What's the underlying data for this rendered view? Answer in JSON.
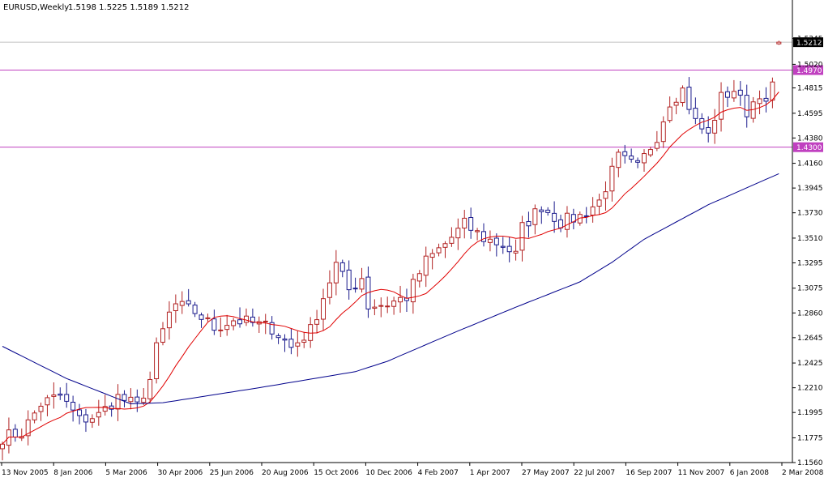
{
  "header": {
    "symbol": "EURUSD,Weekly",
    "ohlc": "1.5198 1.5225 1.5189 1.5212"
  },
  "chart_data": {
    "type": "candlestick",
    "symbol": "EURUSD",
    "timeframe": "Weekly",
    "title": "EURUSD,Weekly",
    "ylim": [
      1.156,
      1.5445
    ],
    "y_ticks": [
      "1.5245",
      "1.5020",
      "1.4815",
      "1.4595",
      "1.4380",
      "1.4160",
      "1.3945",
      "1.3730",
      "1.3510",
      "1.3295",
      "1.3075",
      "1.2860",
      "1.2645",
      "1.2425",
      "1.2210",
      "1.1995",
      "1.1775",
      "1.1560"
    ],
    "x_ticks": [
      "13 Nov 2005",
      "8 Jan 2006",
      "5 Mar 2006",
      "30 Apr 2006",
      "25 Jun 2006",
      "20 Aug 2006",
      "15 Oct 2006",
      "10 Dec 2006",
      "4 Feb 2007",
      "1 Apr 2007",
      "27 May 2007",
      "22 Jul 2007",
      "16 Sep 2007",
      "11 Nov 2007",
      "6 Jan 2008",
      "2 Mar 2008"
    ],
    "price_levels": [
      {
        "value": 1.5212,
        "label": "1.5212",
        "kind": "current",
        "color": "#000000"
      },
      {
        "value": 1.497,
        "label": "1.4970",
        "kind": "horizontal-line",
        "color": "#c040c0"
      },
      {
        "value": 1.43,
        "label": "1.4300",
        "kind": "horizontal-line",
        "color": "#c040c0"
      }
    ],
    "colors": {
      "bull": "#b22222",
      "bear": "#1a1a8c",
      "fast_ma": "#e00000",
      "slow_ma": "#00008b",
      "hline": "#c040c0",
      "current_line": "#c0c0c0"
    },
    "close_keyframes": [
      [
        0,
        1.178
      ],
      [
        3,
        1.182
      ],
      [
        6,
        1.207
      ],
      [
        9,
        1.214
      ],
      [
        12,
        1.193
      ],
      [
        15,
        1.197
      ],
      [
        18,
        1.213
      ],
      [
        21,
        1.205
      ],
      [
        23,
        1.228
      ],
      [
        24,
        1.255
      ],
      [
        26,
        1.285
      ],
      [
        27,
        1.293
      ],
      [
        30,
        1.287
      ],
      [
        33,
        1.273
      ],
      [
        36,
        1.28
      ],
      [
        39,
        1.277
      ],
      [
        42,
        1.273
      ],
      [
        45,
        1.256
      ],
      [
        48,
        1.271
      ],
      [
        50,
        1.3
      ],
      [
        52,
        1.328
      ],
      [
        54,
        1.306
      ],
      [
        56,
        1.317
      ],
      [
        57,
        1.292
      ],
      [
        60,
        1.294
      ],
      [
        63,
        1.3
      ],
      [
        66,
        1.331
      ],
      [
        69,
        1.346
      ],
      [
        72,
        1.363
      ],
      [
        75,
        1.351
      ],
      [
        78,
        1.345
      ],
      [
        80,
        1.336
      ],
      [
        81,
        1.36
      ],
      [
        84,
        1.379
      ],
      [
        87,
        1.365
      ],
      [
        90,
        1.37
      ],
      [
        93,
        1.383
      ],
      [
        96,
        1.421
      ],
      [
        99,
        1.412
      ],
      [
        102,
        1.44
      ],
      [
        104,
        1.47
      ],
      [
        106,
        1.48
      ],
      [
        108,
        1.452
      ],
      [
        110,
        1.44
      ],
      [
        112,
        1.473
      ],
      [
        114,
        1.48
      ],
      [
        116,
        1.461
      ],
      [
        118,
        1.478
      ],
      [
        119,
        1.465
      ],
      [
        120,
        1.485
      ],
      [
        121,
        1.521
      ]
    ],
    "slow_ma_keyframes": [
      [
        0,
        1.257
      ],
      [
        10,
        1.229
      ],
      [
        20,
        1.207
      ],
      [
        25,
        1.208
      ],
      [
        40,
        1.221
      ],
      [
        55,
        1.235
      ],
      [
        60,
        1.244
      ],
      [
        70,
        1.268
      ],
      [
        80,
        1.291
      ],
      [
        90,
        1.313
      ],
      [
        95,
        1.33
      ],
      [
        100,
        1.35
      ],
      [
        110,
        1.38
      ],
      [
        121,
        1.407
      ]
    ]
  }
}
